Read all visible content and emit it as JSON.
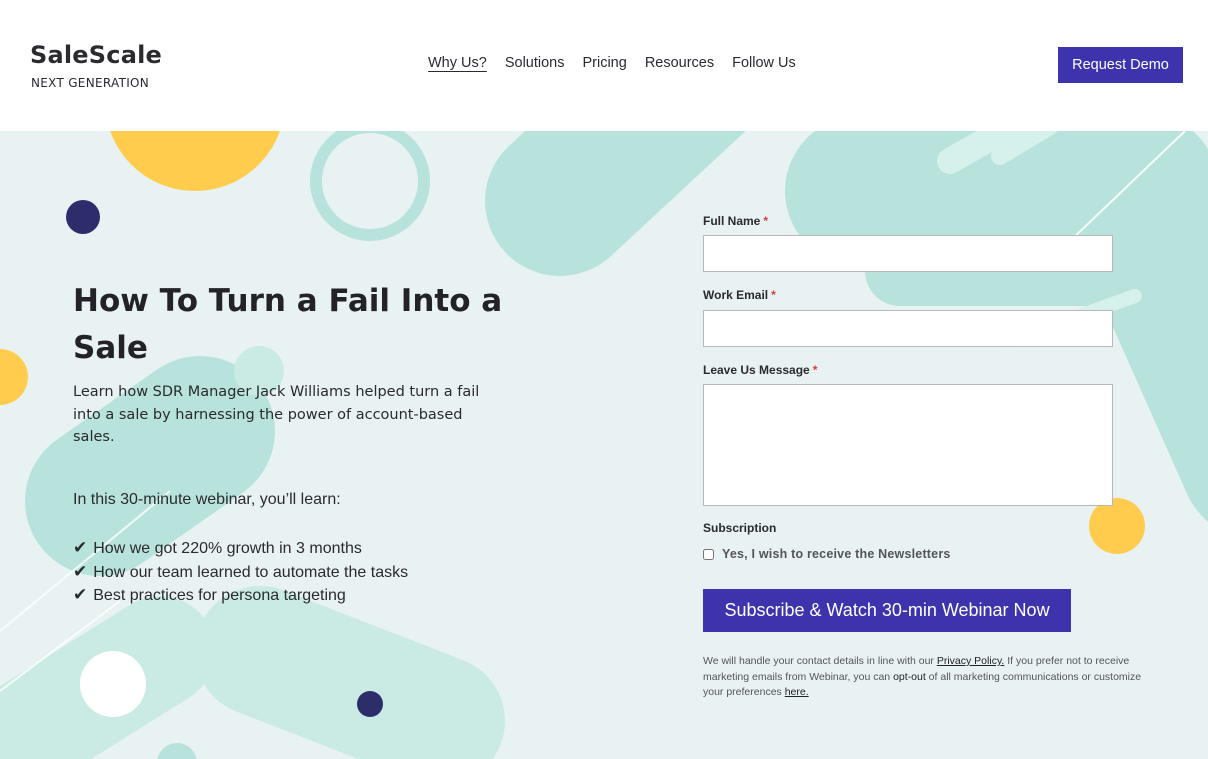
{
  "brand": {
    "name": "SaleScale",
    "tagline": "NEXT GENERATION"
  },
  "nav": {
    "items": [
      {
        "label": "Why Us?",
        "active": true
      },
      {
        "label": "Solutions"
      },
      {
        "label": "Pricing"
      },
      {
        "label": "Resources"
      },
      {
        "label": "Follow Us"
      }
    ],
    "cta_label": "Request Demo"
  },
  "hero": {
    "title": "How To Turn a Fail Into a Sale",
    "description": "Learn how SDR Manager Jack Williams helped turn a fail into a sale by harnessing the power of account-based sales.",
    "learn_intro": "In this 30-minute webinar, you’ll learn:",
    "bullets": [
      {
        "icon": "✔",
        "text": "How we got 220% growth in 3 months"
      },
      {
        "icon": "✔",
        "text": "How our team learned to automate the tasks"
      },
      {
        "icon": "✔",
        "text": "Best practices for persona targeting"
      }
    ]
  },
  "form": {
    "full_name": {
      "label": "Full Name",
      "required_mark": "*",
      "value": ""
    },
    "work_email": {
      "label": "Work Email",
      "required_mark": "*",
      "value": ""
    },
    "message": {
      "label": "Leave Us Message",
      "required_mark": "*",
      "value": ""
    },
    "subscription": {
      "label": "Subscription",
      "checkbox_label": "Yes, I wish to receive the Newsletters",
      "checked": false
    },
    "submit_label": "Subscribe & Watch 30-min Webinar Now",
    "privacy": {
      "part1": "We will handle your contact details in line with our ",
      "policy_link": "Privacy Policy.",
      "part2": " If you prefer not to receive marketing emails from Webinar, you can ",
      "opt_out": "opt-out",
      "part3": " of all marketing communications or customize your preferences ",
      "here_link": "here."
    }
  },
  "colors": {
    "accent": "#3d34ad",
    "hero_bg": "#e8f2f3",
    "mint": "#b8e3dc",
    "yellow": "#ffcc4d",
    "navy": "#2d2d6b"
  }
}
